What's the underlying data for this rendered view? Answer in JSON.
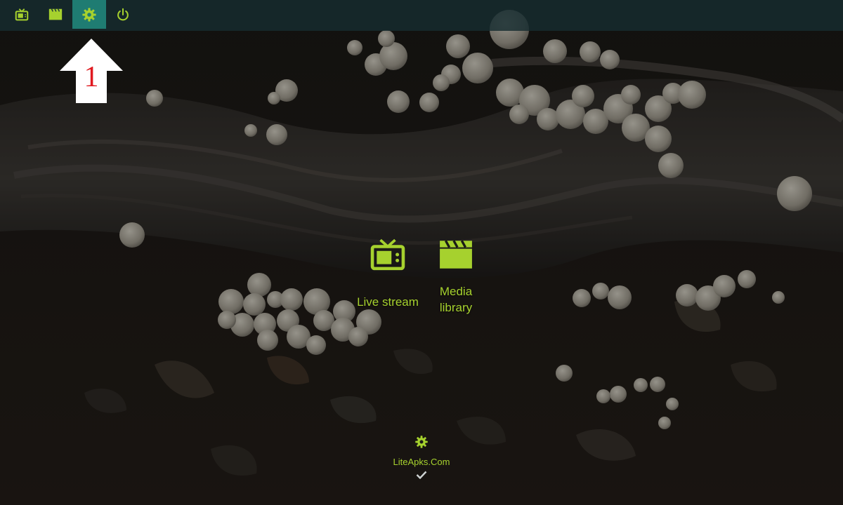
{
  "topbar": {
    "items": [
      {
        "icon": "tv-icon",
        "active": false
      },
      {
        "icon": "clapperboard-icon",
        "active": false
      },
      {
        "icon": "gear-icon",
        "active": true
      },
      {
        "icon": "power-icon",
        "active": false
      }
    ]
  },
  "annotation": {
    "arrow_number": "1"
  },
  "tiles": [
    {
      "icon": "tv-icon",
      "label": "Live stream"
    },
    {
      "icon": "clapperboard-icon",
      "label": "Media\nlibrary"
    }
  ],
  "footer": {
    "icon": "gear-icon",
    "watermark": "LiteApks.Com",
    "check_icon": "checkmark-icon"
  },
  "colors": {
    "accent": "#a6d12e",
    "topbar_bg": "#162c30",
    "active_tab": "#1f7c72",
    "annotation_red": "#e0191f"
  }
}
